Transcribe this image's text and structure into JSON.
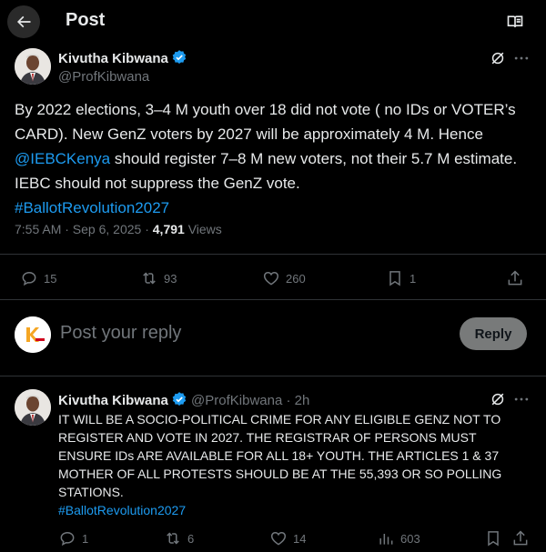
{
  "header": {
    "title": "Post",
    "back_icon": "arrow-left-icon",
    "reader_icon": "book-open-icon"
  },
  "main_post": {
    "author_name": "Kivutha Kibwana",
    "author_handle": "@ProfKibwana",
    "text_before_mention": "By 2022 elections, 3–4 M youth over 18  did not vote ( no IDs or VOTER’s CARD). New GenZ voters by 2027 will be approximately 4 M. Hence ",
    "mention": "@IEBCKenya",
    "text_after_mention": " should register 7–8 M new voters, not their 5.7 M estimate. IEBC should not suppress the GenZ vote.",
    "hashtag": "#BallotRevolution2027",
    "timestamp": "7:55 AM · Sep 6, 2025 · ",
    "views_count": "4,791",
    "views_label": " Views",
    "actions": {
      "replies": "15",
      "reposts": "93",
      "likes": "260",
      "bookmarks": "1"
    }
  },
  "reply_composer": {
    "placeholder": "Post your reply",
    "button_label": "Reply"
  },
  "reply_post": {
    "author_name": "Kivutha Kibwana",
    "author_handle": "@ProfKibwana",
    "time": " · 2h",
    "text": "IT WILL BE A SOCIO-POLITICAL CRIME FOR ANY ELIGIBLE GENZ NOT TO REGISTER AND VOTE IN 2027. THE REGISTRAR OF PERSONS MUST ENSURE IDs ARE AVAILABLE FOR ALL 18+ YOUTH. THE ARTICLES 1 & 37 MOTHER OF ALL PROTESTS SHOULD BE AT THE 55,393 OR SO POLLING STATIONS.",
    "hashtag": "#BallotRevolution2027",
    "actions": {
      "replies": "1",
      "reposts": "6",
      "likes": "14",
      "views": "603"
    }
  },
  "colors": {
    "accent": "#1d9bf0",
    "background": "#000000",
    "muted": "#71767b"
  }
}
